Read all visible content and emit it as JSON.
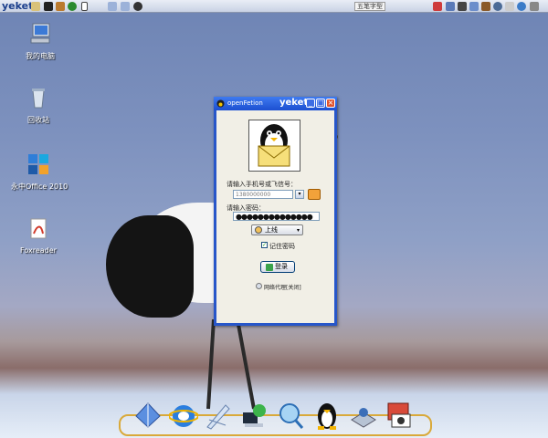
{
  "top_panel": {
    "brand": "yeket",
    "ime_indicator": "五笔字型",
    "launcher_icons": [
      "ie-icon",
      "folder-icon",
      "terminal-icon",
      "browser-icon",
      "firefox-icon",
      "monitor-icon",
      "back-icon",
      "forward-icon",
      "qq-icon"
    ],
    "tray_icons": [
      "network-icon",
      "chart-icon",
      "printer-icon",
      "flag-icon",
      "pen-icon",
      "settings-icon",
      "speaker-icon",
      "globe-icon",
      "keyboard-icon"
    ]
  },
  "desktop": {
    "icons": [
      {
        "name": "my-computer",
        "label": "我的电脑"
      },
      {
        "name": "recycle-bin",
        "label": "回收站"
      },
      {
        "name": "yozo-office",
        "label": "永中Office 2010"
      },
      {
        "name": "foxit-reader",
        "label": "Foxreader"
      }
    ]
  },
  "window": {
    "title": "openFetion",
    "brand": "yeket",
    "phone_label": "请输入手机号或飞信号：",
    "phone_value": "1380000000",
    "password_label": "请输入密码：",
    "password_masked": "●●●●●●●●●●●●●●",
    "status_value": "上线",
    "remember_label": "记住密码",
    "remember_checked": "✓",
    "login_label": "登录",
    "proxy_label": "网络代理[关闭]"
  },
  "dock": {
    "icons": [
      "file-manager-icon",
      "internet-explorer-icon",
      "text-editor-icon",
      "network-icon",
      "search-icon",
      "qq-penguin-icon",
      "drive-icon",
      "photo-viewer-icon"
    ]
  },
  "colors": {
    "titlebar": "#1c4fd1",
    "window_border": "#2756c9",
    "dock_border": "#d9a93a",
    "close_button": "#e0552f"
  }
}
